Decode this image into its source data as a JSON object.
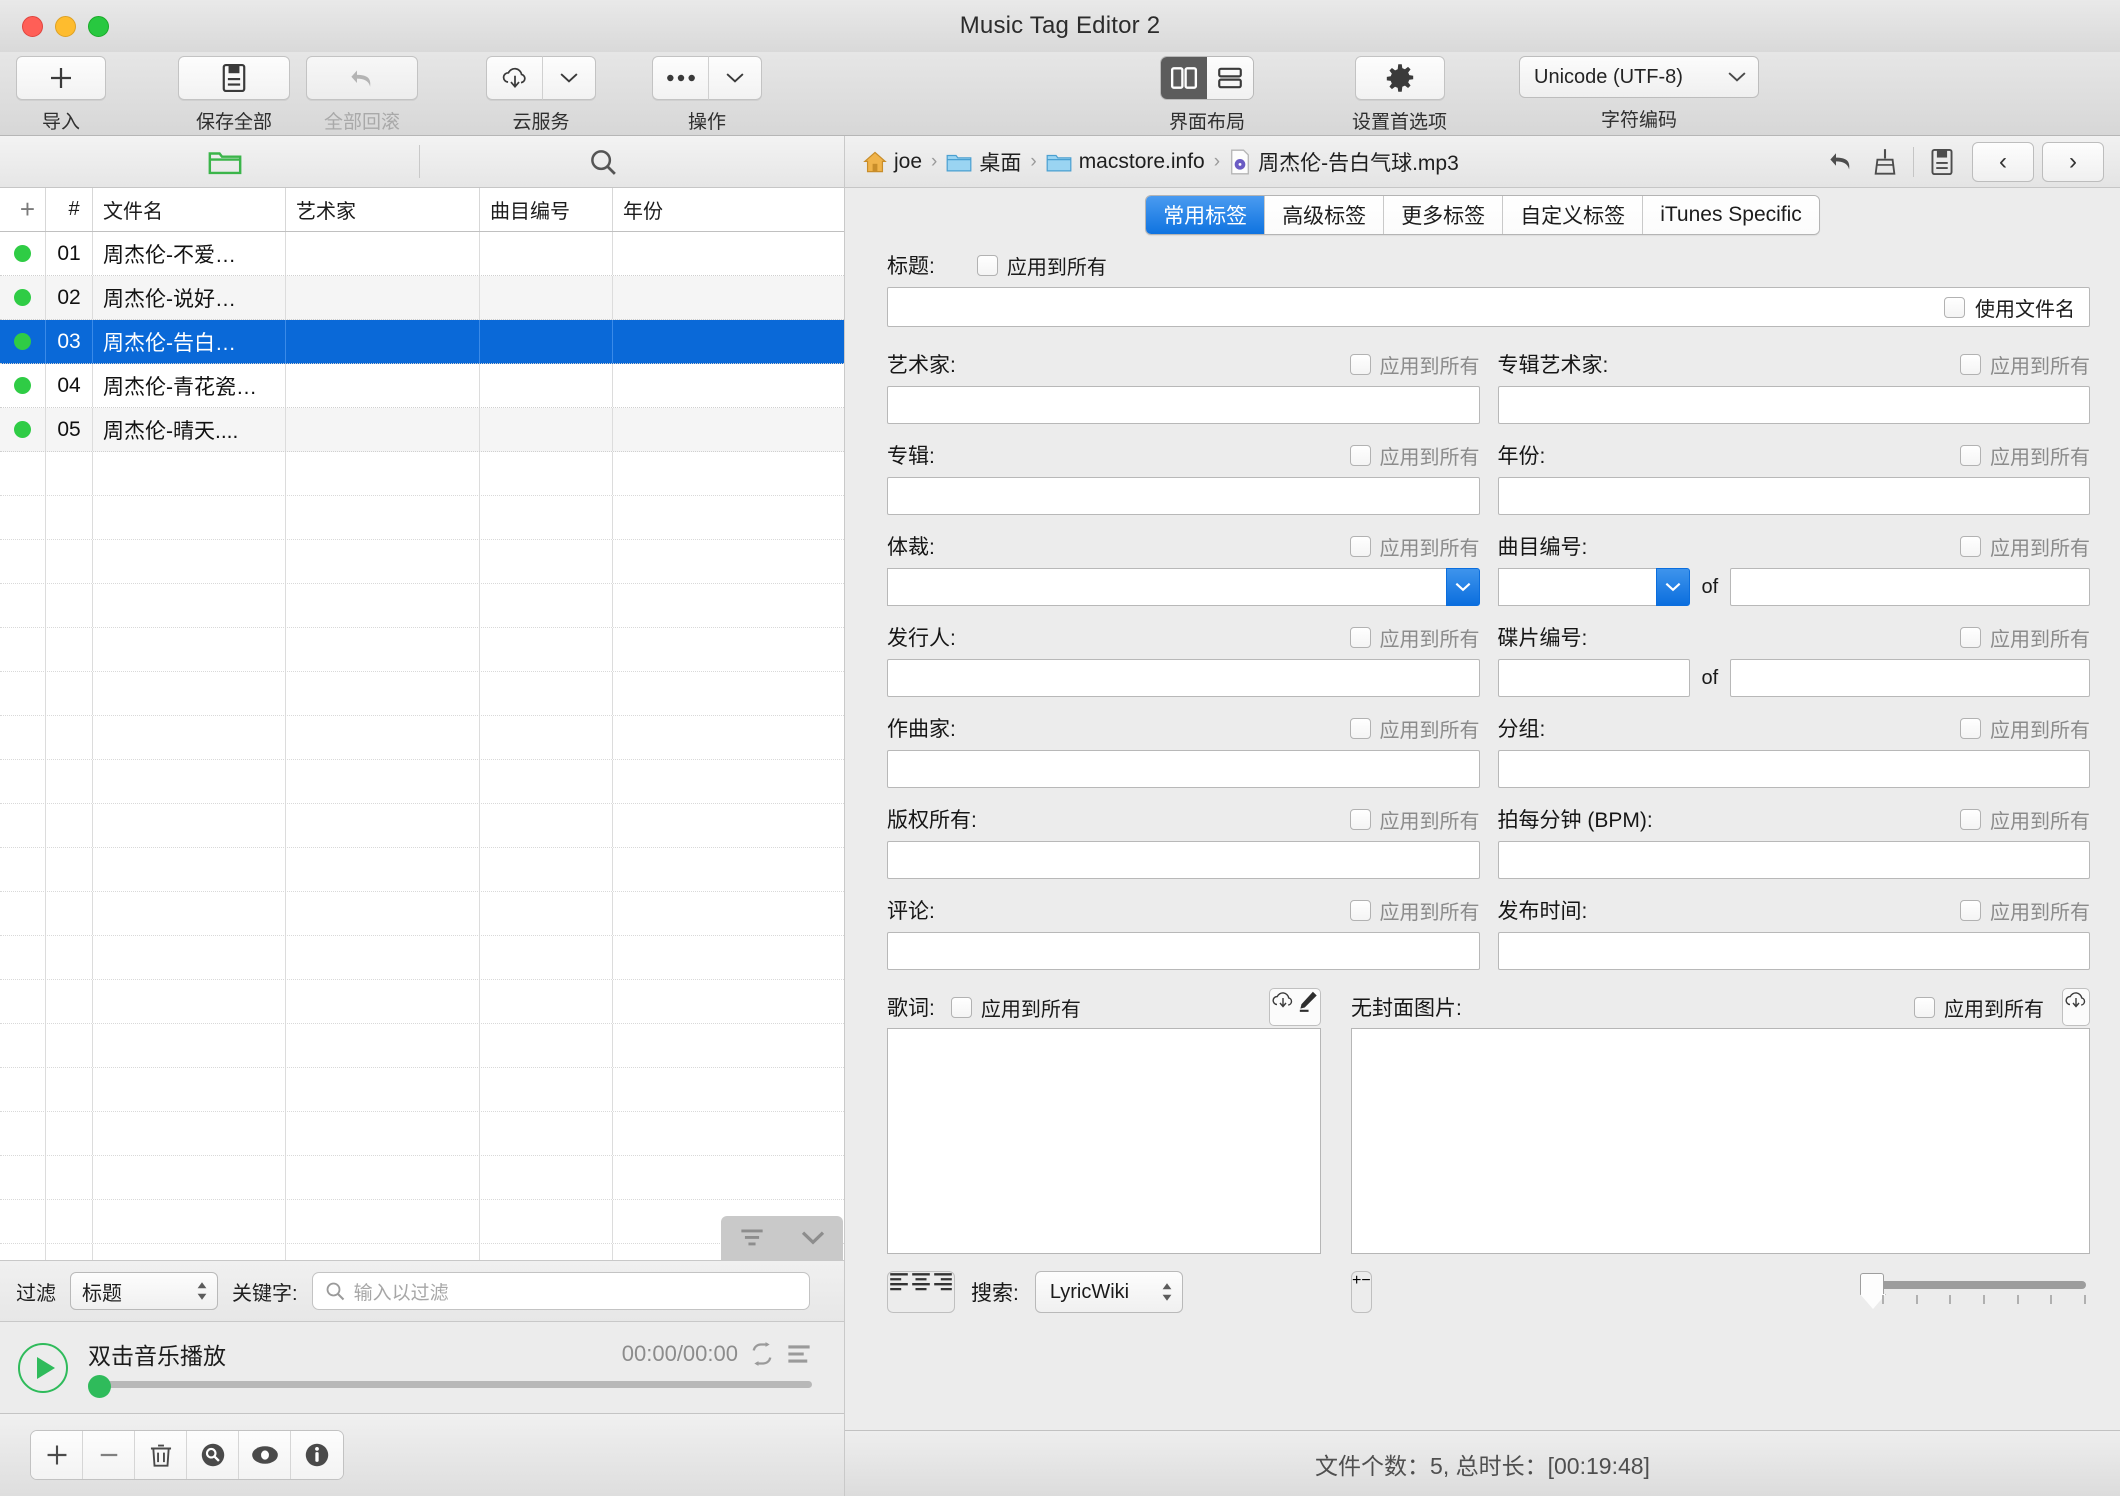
{
  "window": {
    "title": "Music Tag Editor 2"
  },
  "toolbar": {
    "import_label": "导入",
    "save_all_label": "保存全部",
    "rollback_all_label": "全部回滚",
    "cloud_label": "云服务",
    "actions_label": "操作",
    "layout_label": "界面布局",
    "preferences_label": "设置首选项",
    "encoding_label": "字符编码",
    "encoding_value": "Unicode (UTF-8)"
  },
  "filelist": {
    "columns": [
      "+",
      "#",
      "文件名",
      "艺术家",
      "曲目编号",
      "年份"
    ],
    "rows": [
      {
        "num": "01",
        "name": "周杰伦-不爱…",
        "artist": "",
        "track": "",
        "year": ""
      },
      {
        "num": "02",
        "name": "周杰伦-说好…",
        "artist": "",
        "track": "",
        "year": ""
      },
      {
        "num": "03",
        "name": "周杰伦-告白…",
        "artist": "",
        "track": "",
        "year": ""
      },
      {
        "num": "04",
        "name": "周杰伦-青花瓷…",
        "artist": "",
        "track": "",
        "year": ""
      },
      {
        "num": "05",
        "name": "周杰伦-晴天....",
        "artist": "",
        "track": "",
        "year": ""
      }
    ],
    "selected_index": 2
  },
  "filter": {
    "label": "过滤",
    "field_value": "标题",
    "keyword_label": "关键字:",
    "keyword_placeholder": "输入以过滤"
  },
  "player": {
    "title": "双击音乐播放",
    "time": "00:00/00:00"
  },
  "breadcrumb": {
    "items": [
      {
        "label": "joe",
        "icon": "home-icon"
      },
      {
        "label": "桌面",
        "icon": "folder-icon"
      },
      {
        "label": "macstore.info",
        "icon": "folder-icon"
      },
      {
        "label": "周杰伦-告白气球.mp3",
        "icon": "audio-file-icon"
      }
    ],
    "separator": "›"
  },
  "tabs": [
    {
      "label": "常用标签",
      "active": true
    },
    {
      "label": "高级标签",
      "active": false
    },
    {
      "label": "更多标签",
      "active": false
    },
    {
      "label": "自定义标签",
      "active": false
    },
    {
      "label": "iTunes Specific",
      "active": false
    }
  ],
  "form": {
    "apply_all": "应用到所有",
    "use_filename": "使用文件名",
    "of": "of",
    "title": {
      "label": "标题:",
      "value": ""
    },
    "artist": {
      "label": "艺术家:",
      "value": ""
    },
    "album_artist": {
      "label": "专辑艺术家:",
      "value": ""
    },
    "album": {
      "label": "专辑:",
      "value": ""
    },
    "year": {
      "label": "年份:",
      "value": ""
    },
    "genre": {
      "label": "体裁:",
      "value": ""
    },
    "track_number": {
      "label": "曲目编号:",
      "value": "",
      "total": ""
    },
    "publisher": {
      "label": "发行人:",
      "value": ""
    },
    "disc_number": {
      "label": "碟片编号:",
      "value": "",
      "total": ""
    },
    "composer": {
      "label": "作曲家:",
      "value": ""
    },
    "grouping": {
      "label": "分组:",
      "value": ""
    },
    "copyright": {
      "label": "版权所有:",
      "value": ""
    },
    "bpm": {
      "label": "拍每分钟 (BPM):",
      "value": ""
    },
    "comment": {
      "label": "评论:",
      "value": ""
    },
    "release_time": {
      "label": "发布时间:",
      "value": ""
    }
  },
  "lyrics": {
    "label": "歌词:",
    "apply_all": "应用到所有",
    "text": "",
    "search_label": "搜索:",
    "search_source": "LyricWiki"
  },
  "artwork": {
    "label": "无封面图片:",
    "apply_all": "应用到所有",
    "add_label": "+",
    "remove_label": "−"
  },
  "status": {
    "text": "文件个数：5, 总时长：[00:19:48]"
  },
  "colors": {
    "selection_blue": "#0a69d8",
    "tab_active_blue": "#0f73e0",
    "status_dot_green": "#2fcc45",
    "play_green": "#2fbb5b"
  }
}
